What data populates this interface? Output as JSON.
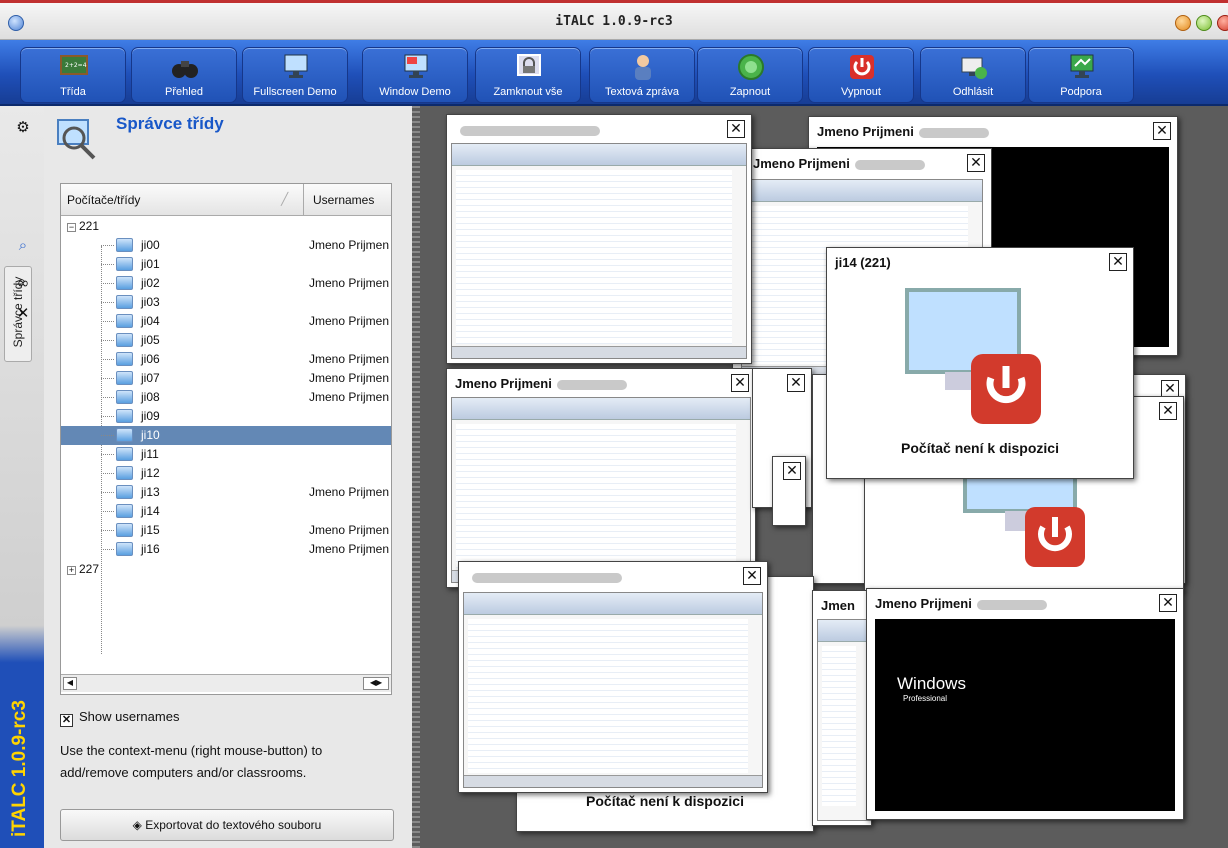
{
  "window": {
    "title": "iTALC 1.0.9-rc3"
  },
  "toolbar": {
    "buttons": [
      {
        "label": "Třída",
        "icon": "classroom-board-icon"
      },
      {
        "label": "Přehled",
        "icon": "binoculars-icon"
      },
      {
        "label": "Fullscreen Demo",
        "icon": "fullscreen-demo-icon"
      },
      {
        "label": "Window Demo",
        "icon": "window-demo-icon"
      },
      {
        "label": "Zamknout vše",
        "icon": "lock-screen-icon"
      },
      {
        "label": "Textová zpráva",
        "icon": "text-message-icon"
      },
      {
        "label": "Zapnout",
        "icon": "power-on-icon"
      },
      {
        "label": "Vypnout",
        "icon": "power-off-icon"
      },
      {
        "label": "Odhlásit",
        "icon": "logout-icon"
      },
      {
        "label": "Podpora",
        "icon": "support-icon"
      }
    ]
  },
  "sidebar": {
    "tab_label": "Správce třídy",
    "brand": "iTALC 1.0.9-rc3"
  },
  "panel": {
    "title": "Správce třídy",
    "columns": {
      "computers": "Počítače/třídy",
      "usernames": "Usernames"
    },
    "groups": [
      {
        "name": "221"
      },
      {
        "name": "227"
      }
    ],
    "rows": [
      {
        "name": "ji00",
        "user": "Jmeno Prijmen"
      },
      {
        "name": "ji01",
        "user": ""
      },
      {
        "name": "ji02",
        "user": "Jmeno Prijmen"
      },
      {
        "name": "ji03",
        "user": ""
      },
      {
        "name": "ji04",
        "user": "Jmeno Prijmen"
      },
      {
        "name": "ji05",
        "user": ""
      },
      {
        "name": "ji06",
        "user": "Jmeno Prijmen"
      },
      {
        "name": "ji07",
        "user": "Jmeno Prijmen"
      },
      {
        "name": "ji08",
        "user": "Jmeno Prijmen"
      },
      {
        "name": "ji09",
        "user": ""
      },
      {
        "name": "ji10",
        "user": ""
      },
      {
        "name": "ji11",
        "user": ""
      },
      {
        "name": "ji12",
        "user": ""
      },
      {
        "name": "ji13",
        "user": "Jmeno Prijmen"
      },
      {
        "name": "ji14",
        "user": ""
      },
      {
        "name": "ji15",
        "user": "Jmeno Prijmen"
      },
      {
        "name": "ji16",
        "user": "Jmeno Prijmen"
      }
    ],
    "show_usernames": "Show usernames",
    "hint": "Use the context-menu (right mouse-button) to add/remove computers and/or classrooms.",
    "export_label": "Exportovat do textového souboru"
  },
  "screens": {
    "s1": {
      "title": "Jmeno Prijmeni"
    },
    "s2": {
      "title": "Jmeno Prijmeni"
    },
    "s3": {
      "title": "Jmeno Prijmeni"
    },
    "s4": {
      "title": "ji14 (221)",
      "message": "Počítač není k dispozici"
    },
    "s5": {
      "title": "Jmeno Prijmeni"
    },
    "s6": {
      "title": "Jmen"
    },
    "s7": {
      "title": "Jmeno Prijmeni",
      "logo_text": "Windows",
      "logo_sub": "Professional"
    },
    "s8": {
      "message": "Počítač není k dispozici"
    },
    "s9": {
      "title": "Jmeno Prijmeni ("
    }
  }
}
